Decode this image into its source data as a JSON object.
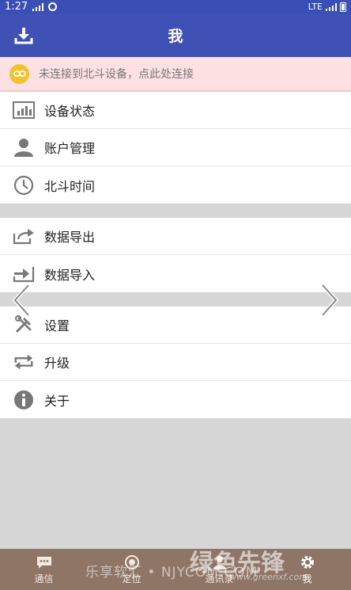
{
  "status_bar": {
    "time": "1:27",
    "network": "LTE"
  },
  "app_bar": {
    "title": "我"
  },
  "banner": {
    "text": "未连接到北斗设备，点此处连接"
  },
  "group1": [
    {
      "label": "设备状态",
      "icon": "bar-chart-icon"
    },
    {
      "label": "账户管理",
      "icon": "person-icon"
    },
    {
      "label": "北斗时间",
      "icon": "clock-icon"
    }
  ],
  "group2": [
    {
      "label": "数据导出",
      "icon": "export-icon"
    },
    {
      "label": "数据导入",
      "icon": "import-icon"
    }
  ],
  "group3": [
    {
      "label": "设置",
      "icon": "tools-icon"
    },
    {
      "label": "升级",
      "icon": "refresh-icon"
    },
    {
      "label": "关于",
      "icon": "info-icon"
    }
  ],
  "bottom_nav": [
    {
      "label": "通信",
      "icon": "chat-icon"
    },
    {
      "label": "定位",
      "icon": "location-icon"
    },
    {
      "label": "通讯录",
      "icon": "contacts-icon"
    },
    {
      "label": "我",
      "icon": "gear-icon"
    }
  ],
  "watermark": {
    "text1": "乐享软汇 • NJYCOM.COM",
    "text2": "绿色先锋",
    "text3": "www.greenxf.com"
  },
  "colors": {
    "primary": "#3f51b5",
    "banner_bg": "#fde0e2",
    "link_icon": "#f0c22e",
    "bottom_nav": "#8f7566"
  }
}
